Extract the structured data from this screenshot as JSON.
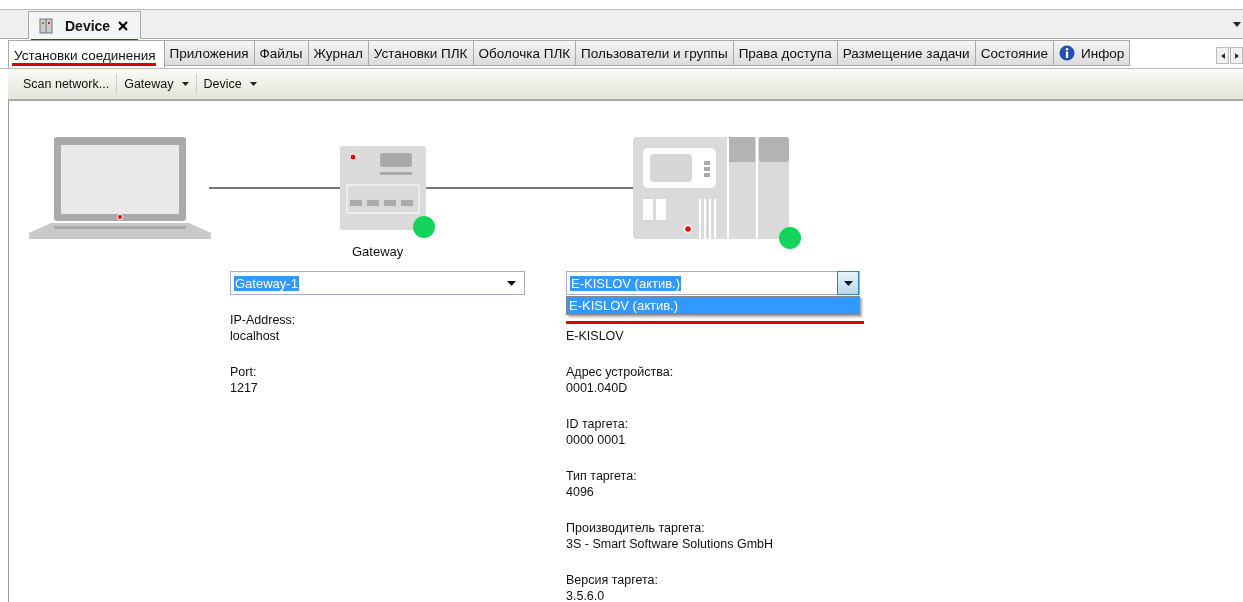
{
  "document_tab": {
    "title": "Device",
    "marked": true
  },
  "tabs": [
    {
      "label": "Установки соединения",
      "selected": true,
      "marked": true
    },
    {
      "label": "Приложения",
      "selected": false,
      "marked": false
    },
    {
      "label": "Файлы",
      "selected": false,
      "marked": false
    },
    {
      "label": "Журнал",
      "selected": false,
      "marked": false
    },
    {
      "label": "Установки ПЛК",
      "selected": false,
      "marked": false
    },
    {
      "label": "Оболочка ПЛК",
      "selected": false,
      "marked": false
    },
    {
      "label": "Пользователи и группы",
      "selected": false,
      "marked": false
    },
    {
      "label": "Права доступа",
      "selected": false,
      "marked": false
    },
    {
      "label": "Размещение задачи",
      "selected": false,
      "marked": false
    },
    {
      "label": "Состояние",
      "selected": false,
      "marked": false
    },
    {
      "label": "Инфор",
      "selected": false,
      "marked": false,
      "kind": "info"
    }
  ],
  "toolbar": [
    {
      "label": "Scan network...",
      "dropdown": false
    },
    {
      "label": "Gateway",
      "dropdown": true
    },
    {
      "label": "Device",
      "dropdown": true
    }
  ],
  "gateway": {
    "label": "Gateway",
    "online": true
  },
  "device": {
    "online": true
  },
  "gateway_combo": {
    "value": "Gateway-1"
  },
  "gateway_fields": [
    {
      "label": "IP-Address:",
      "value": "localhost"
    },
    {
      "label": "Port:",
      "value": "1217"
    }
  ],
  "device_combo": {
    "value": "E-KISLOV (актив.)",
    "expanded": true,
    "marked": true,
    "options": [
      {
        "label": "E-KISLOV (актив.)",
        "selected": true
      }
    ]
  },
  "device_fields": [
    {
      "value": "E-KISLOV"
    },
    {
      "label": "Адрес устройства:",
      "value": "0001.040D"
    },
    {
      "label": "ID таргета:",
      "value": "0000 0001"
    },
    {
      "label": "Тип таргета:",
      "value": "4096"
    },
    {
      "label": "Производитель таргета:",
      "value": "3S - Smart Software Solutions GmbH"
    },
    {
      "label": "Версия таргета:",
      "value": "3.5.6.0"
    }
  ]
}
